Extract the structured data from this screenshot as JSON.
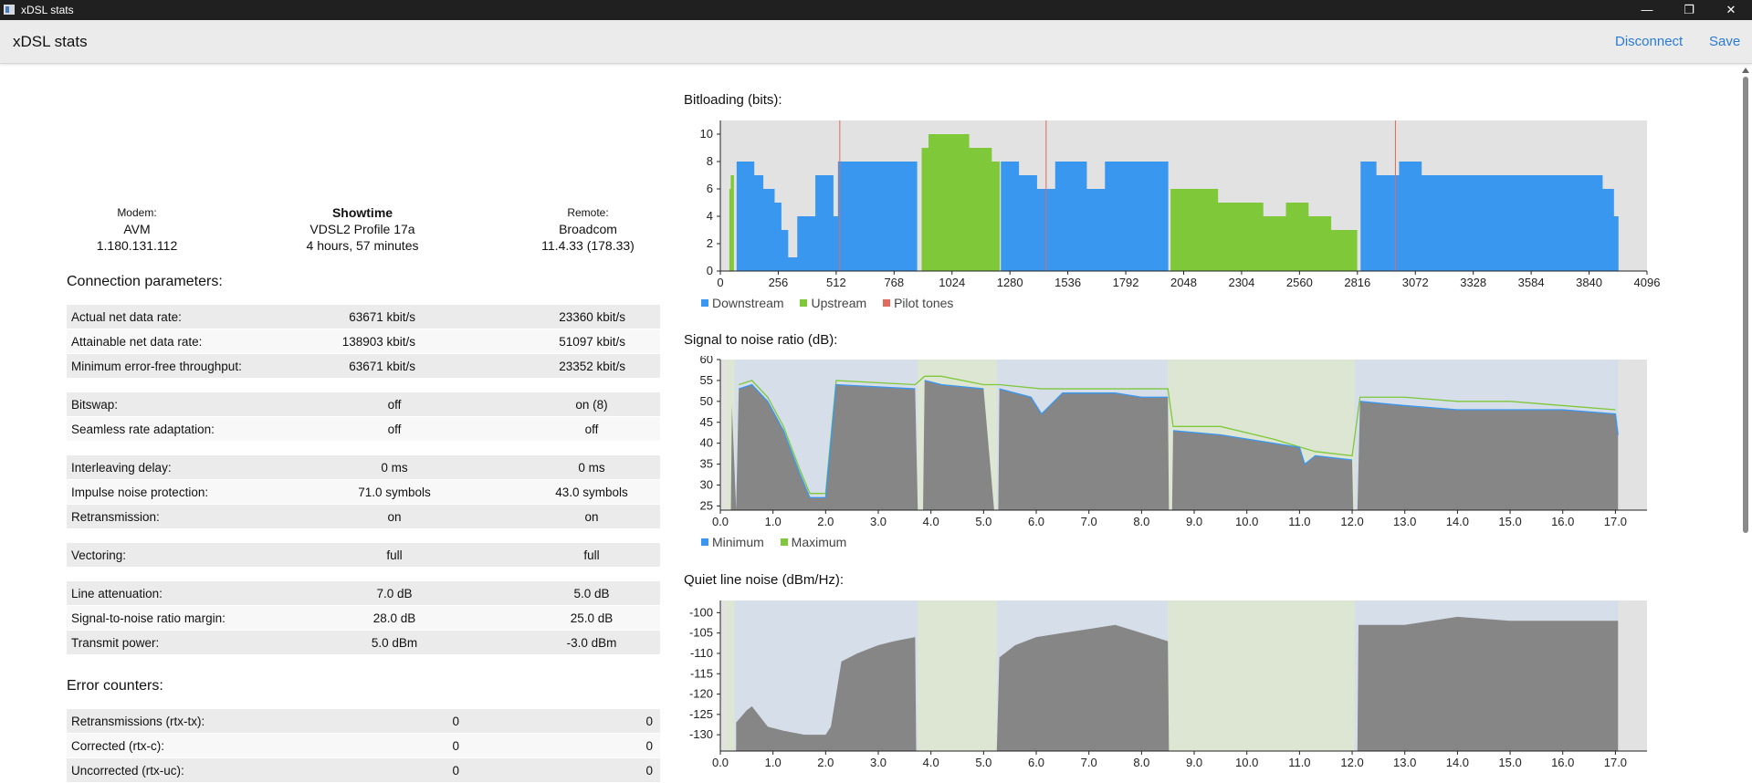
{
  "window": {
    "title": "xDSL stats"
  },
  "header": {
    "title": "xDSL stats",
    "disconnect": "Disconnect",
    "save": "Save"
  },
  "device": {
    "modem": {
      "label": "Modem:",
      "vendor": "AVM",
      "version": "1.180.131.112"
    },
    "state": {
      "status": "Showtime",
      "mode": "VDSL2 Profile 17a",
      "uptime": "4 hours, 57 minutes"
    },
    "remote": {
      "label": "Remote:",
      "vendor": "Broadcom",
      "version": "11.4.33 (178.33)"
    }
  },
  "connection": {
    "title": "Connection parameters:",
    "rows": [
      {
        "label": "Actual net data rate:",
        "down": "63671 kbit/s",
        "up": "23360 kbit/s"
      },
      {
        "label": "Attainable net data rate:",
        "down": "138903 kbit/s",
        "up": "51097 kbit/s"
      },
      {
        "label": "Minimum error-free throughput:",
        "down": "63671 kbit/s",
        "up": "23352 kbit/s"
      },
      {
        "label": "Bitswap:",
        "down": "off",
        "up": "on (8)"
      },
      {
        "label": "Seamless rate adaptation:",
        "down": "off",
        "up": "off"
      },
      {
        "label": "Interleaving delay:",
        "down": "0 ms",
        "up": "0 ms"
      },
      {
        "label": "Impulse noise protection:",
        "down": "71.0 symbols",
        "up": "43.0 symbols"
      },
      {
        "label": "Retransmission:",
        "down": "on",
        "up": "on"
      },
      {
        "label": "Vectoring:",
        "down": "full",
        "up": "full"
      },
      {
        "label": "Line attenuation:",
        "down": "7.0 dB",
        "up": "5.0 dB"
      },
      {
        "label": "Signal-to-noise ratio margin:",
        "down": "28.0 dB",
        "up": "25.0 dB"
      },
      {
        "label": "Transmit power:",
        "down": "5.0 dBm",
        "up": "-3.0 dBm"
      }
    ]
  },
  "errors": {
    "title": "Error counters:",
    "rows": [
      {
        "label": "Retransmissions (rtx-tx):",
        "down": "0",
        "up": "0"
      },
      {
        "label": "Corrected (rtx-c):",
        "down": "0",
        "up": "0"
      },
      {
        "label": "Uncorrected (rtx-uc):",
        "down": "0",
        "up": "0"
      }
    ]
  },
  "colors": {
    "downstream": "#3a97f0",
    "upstream": "#7ec83a",
    "pilot": "#e06a5c",
    "snr_fill": "#868686",
    "band_down": "#d6dee9",
    "band_up": "#dde6d2",
    "plot_bg": "#e2e2e2"
  },
  "chart_data": [
    {
      "type": "bar",
      "title": "Bitloading (bits):",
      "xlim": [
        0,
        4096
      ],
      "ylim": [
        0,
        11
      ],
      "xticks": [
        "0",
        "256",
        "512",
        "768",
        "1024",
        "1280",
        "1536",
        "1792",
        "2048",
        "2304",
        "2560",
        "2816",
        "3072",
        "3328",
        "3584",
        "3840",
        "4096"
      ],
      "yticks": [
        "0",
        "2",
        "4",
        "6",
        "8",
        "10"
      ],
      "legend": [
        "Downstream",
        "Upstream",
        "Pilot tones"
      ],
      "pilot_tones": [
        528,
        1440,
        2984
      ],
      "series": [
        {
          "name": "Downstream",
          "points": [
            [
              64,
              0
            ],
            [
              72,
              8
            ],
            [
              150,
              7
            ],
            [
              190,
              6
            ],
            [
              240,
              5
            ],
            [
              270,
              3
            ],
            [
              300,
              1
            ],
            [
              340,
              4
            ],
            [
              420,
              7
            ],
            [
              500,
              4
            ],
            [
              520,
              8
            ],
            [
              860,
              8
            ],
            [
              870,
              0
            ],
            [
              1230,
              0
            ],
            [
              1240,
              8
            ],
            [
              1320,
              7
            ],
            [
              1400,
              6
            ],
            [
              1480,
              8
            ],
            [
              1620,
              6
            ],
            [
              1700,
              8
            ],
            [
              1960,
              8
            ],
            [
              1980,
              0
            ],
            [
              2815,
              0
            ],
            [
              2830,
              8
            ],
            [
              2900,
              7
            ],
            [
              3000,
              8
            ],
            [
              3100,
              7
            ],
            [
              3860,
              7
            ],
            [
              3900,
              6
            ],
            [
              3950,
              4
            ],
            [
              3970,
              0
            ]
          ]
        },
        {
          "name": "Upstream",
          "points": [
            [
              32,
              0
            ],
            [
              40,
              6
            ],
            [
              46,
              7
            ],
            [
              60,
              0
            ],
            [
              880,
              0
            ],
            [
              890,
              9
            ],
            [
              920,
              10
            ],
            [
              1000,
              10
            ],
            [
              1100,
              9
            ],
            [
              1200,
              8
            ],
            [
              1230,
              8
            ],
            [
              1235,
              0
            ],
            [
              1985,
              0
            ],
            [
              1990,
              6
            ],
            [
              2200,
              5
            ],
            [
              2400,
              4
            ],
            [
              2500,
              5
            ],
            [
              2600,
              4
            ],
            [
              2700,
              3
            ],
            [
              2815,
              3
            ],
            [
              2815,
              0
            ]
          ]
        }
      ]
    },
    {
      "type": "area",
      "title": "Signal to noise ratio (dB):",
      "xlim": [
        0,
        17.6
      ],
      "ylim": [
        24,
        60
      ],
      "xticks": [
        "0.0",
        "1.0",
        "2.0",
        "3.0",
        "4.0",
        "5.0",
        "6.0",
        "7.0",
        "8.0",
        "9.0",
        "10.0",
        "11.0",
        "12.0",
        "13.0",
        "14.0",
        "15.0",
        "16.0",
        "17.0"
      ],
      "yticks": [
        "25",
        "30",
        "35",
        "40",
        "45",
        "50",
        "55",
        "60"
      ],
      "legend": [
        "Minimum",
        "Maximum"
      ],
      "series": [
        {
          "name": "Minimum",
          "points": [
            [
              0.2,
              0
            ],
            [
              0.22,
              49
            ],
            [
              0.3,
              0
            ],
            [
              0.35,
              53
            ],
            [
              0.6,
              54
            ],
            [
              0.9,
              50
            ],
            [
              1.2,
              43
            ],
            [
              1.5,
              33
            ],
            [
              1.7,
              27
            ],
            [
              2.0,
              27
            ],
            [
              2.2,
              54
            ],
            [
              3.7,
              53
            ],
            [
              3.75,
              0
            ],
            [
              3.85,
              0
            ],
            [
              3.88,
              55
            ],
            [
              4.2,
              54
            ],
            [
              5.0,
              53
            ],
            [
              5.2,
              0
            ],
            [
              5.28,
              0
            ],
            [
              5.3,
              53
            ],
            [
              5.9,
              51
            ],
            [
              6.1,
              47
            ],
            [
              6.5,
              52
            ],
            [
              7.5,
              52
            ],
            [
              8.0,
              51
            ],
            [
              8.5,
              51
            ],
            [
              8.52,
              0
            ],
            [
              8.58,
              0
            ],
            [
              8.6,
              43
            ],
            [
              9.5,
              42
            ],
            [
              10.5,
              40
            ],
            [
              11.0,
              39
            ],
            [
              11.1,
              35
            ],
            [
              11.3,
              37
            ],
            [
              12.0,
              36
            ],
            [
              12.02,
              0
            ],
            [
              12.1,
              0
            ],
            [
              12.15,
              50
            ],
            [
              13.0,
              49
            ],
            [
              14.0,
              48
            ],
            [
              15.0,
              48
            ],
            [
              16.0,
              48
            ],
            [
              17.0,
              47
            ],
            [
              17.05,
              42
            ]
          ]
        },
        {
          "name": "Maximum",
          "points": [
            [
              0.35,
              54
            ],
            [
              0.6,
              55
            ],
            [
              0.9,
              51
            ],
            [
              1.2,
              44
            ],
            [
              1.5,
              34
            ],
            [
              1.7,
              28
            ],
            [
              2.0,
              28
            ],
            [
              2.2,
              55
            ],
            [
              3.7,
              54
            ],
            [
              3.88,
              56
            ],
            [
              4.2,
              56
            ],
            [
              5.0,
              54
            ],
            [
              5.3,
              54
            ],
            [
              6.1,
              53
            ],
            [
              7.5,
              53
            ],
            [
              8.5,
              53
            ],
            [
              8.6,
              44
            ],
            [
              9.5,
              44
            ],
            [
              10.5,
              41
            ],
            [
              11.3,
              38
            ],
            [
              12.0,
              37
            ],
            [
              12.15,
              51
            ],
            [
              13.0,
              51
            ],
            [
              14.0,
              50
            ],
            [
              15.0,
              50
            ],
            [
              16.0,
              49
            ],
            [
              17.0,
              48
            ]
          ]
        }
      ]
    },
    {
      "type": "area",
      "title": "Quiet line noise (dBm/Hz):",
      "xlim": [
        0,
        17.6
      ],
      "ylim": [
        -134,
        -97
      ],
      "xticks": [
        "0.0",
        "1.0",
        "2.0",
        "3.0",
        "4.0",
        "5.0",
        "6.0",
        "7.0",
        "8.0",
        "9.0",
        "10.0",
        "11.0",
        "12.0",
        "13.0",
        "14.0",
        "15.0",
        "16.0",
        "17.0"
      ],
      "yticks": [
        "-100",
        "-105",
        "-110",
        "-115",
        "-120",
        "-125",
        "-130"
      ],
      "series": [
        {
          "name": "",
          "points": [
            [
              0.3,
              -127
            ],
            [
              0.5,
              -124
            ],
            [
              0.6,
              -123
            ],
            [
              0.9,
              -128
            ],
            [
              1.2,
              -129
            ],
            [
              1.6,
              -130
            ],
            [
              2.0,
              -130
            ],
            [
              2.1,
              -128
            ],
            [
              2.3,
              -112
            ],
            [
              2.6,
              -110
            ],
            [
              3.0,
              -108
            ],
            [
              3.3,
              -107
            ],
            [
              3.7,
              -106
            ],
            [
              3.72,
              -134
            ],
            [
              5.25,
              -134
            ],
            [
              5.3,
              -111
            ],
            [
              5.6,
              -108
            ],
            [
              6.0,
              -106
            ],
            [
              6.5,
              -105
            ],
            [
              7.0,
              -104
            ],
            [
              7.5,
              -103
            ],
            [
              8.0,
              -105
            ],
            [
              8.5,
              -107
            ],
            [
              8.52,
              -134
            ],
            [
              12.1,
              -134
            ],
            [
              12.12,
              -103
            ],
            [
              13.0,
              -103
            ],
            [
              14.0,
              -101
            ],
            [
              15.0,
              -102
            ],
            [
              16.0,
              -102
            ],
            [
              17.0,
              -102
            ],
            [
              17.05,
              -102
            ]
          ]
        }
      ]
    }
  ]
}
